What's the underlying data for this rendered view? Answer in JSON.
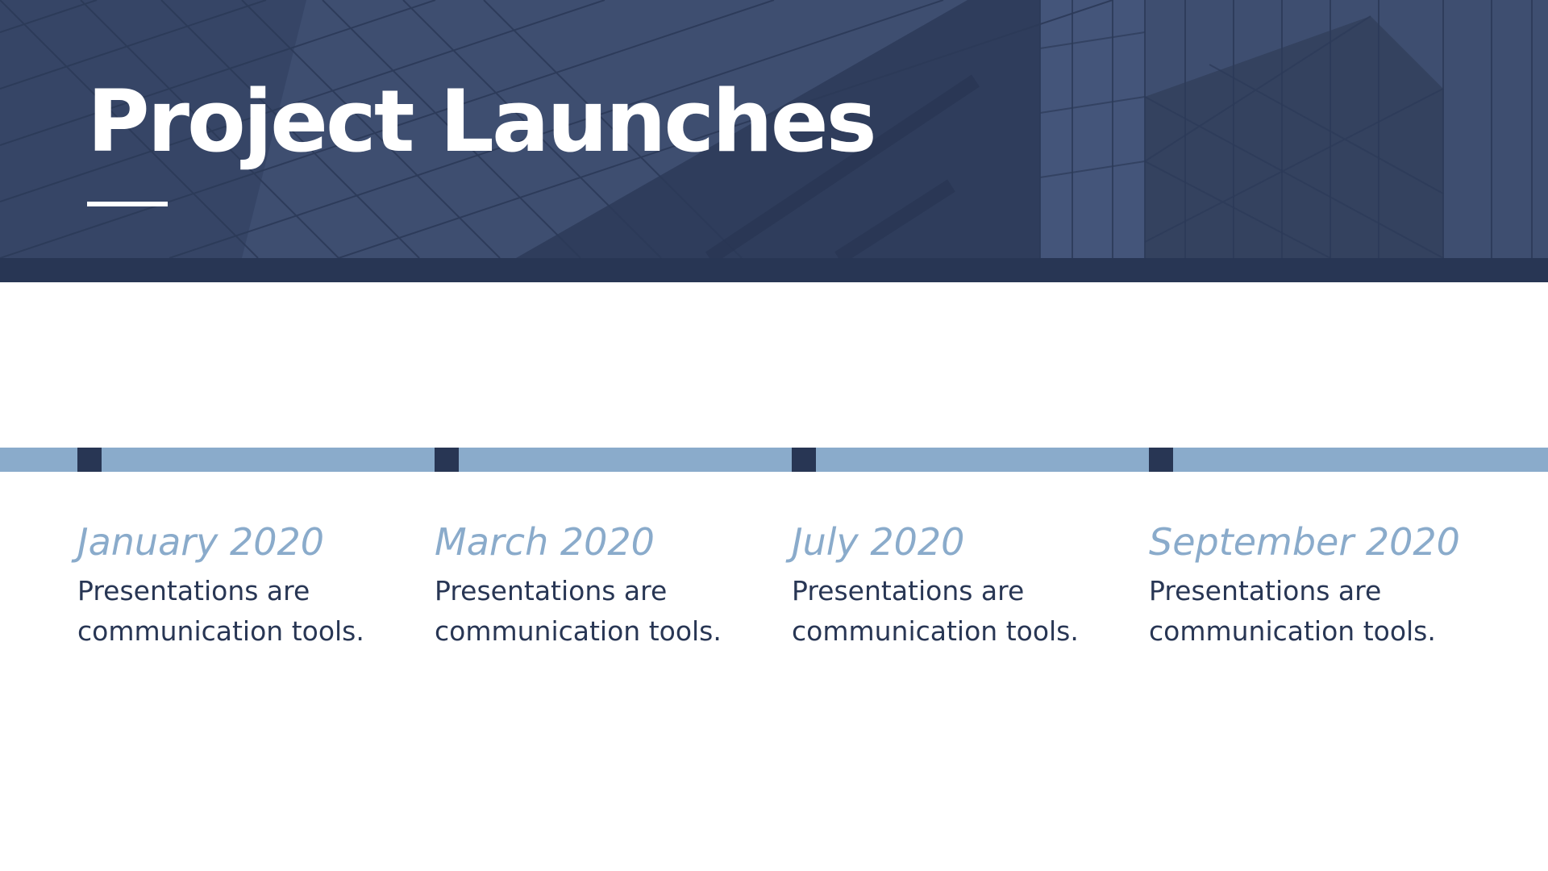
{
  "header": {
    "title": "Project Launches"
  },
  "timeline": {
    "milestones": [
      {
        "date": "January 2020",
        "description": "Presentations are communication tools."
      },
      {
        "date": "March 2020",
        "description": "Presentations are communication tools."
      },
      {
        "date": "July 2020",
        "description": "Presentations are communication tools."
      },
      {
        "date": "September 2020",
        "description": "Presentations are communication tools."
      }
    ]
  },
  "colors": {
    "header_background": "#3d4d6e",
    "dark_navy": "#283654",
    "timeline_blue": "#8aabcb",
    "title_text": "#ffffff",
    "body_text": "#283654"
  }
}
